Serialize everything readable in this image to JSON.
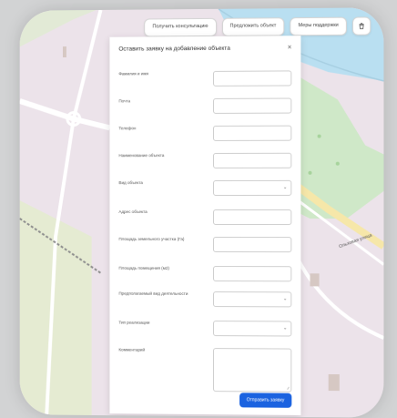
{
  "topbar": {
    "btn_consult": "Получить консультацию",
    "btn_offer": "Предложить объект",
    "btn_support": "Меры поддержки",
    "settings_icon": "settings-icon"
  },
  "modal": {
    "title": "Оставить заявку на добавление объекта",
    "close_icon": "×",
    "fields": [
      {
        "label": "Фамилия и имя",
        "type": "input",
        "value": "",
        "placeholder": ""
      },
      {
        "label": "Почта",
        "type": "input",
        "value": "",
        "placeholder": ""
      },
      {
        "label": "Телефон",
        "type": "input",
        "value": "",
        "placeholder": ""
      },
      {
        "label": "Наименование объекта",
        "type": "input",
        "value": "",
        "placeholder": ""
      },
      {
        "label": "Вид объекта",
        "type": "select",
        "value": "",
        "placeholder": ""
      },
      {
        "label": "Адрес объекта",
        "type": "input",
        "value": "",
        "placeholder": ""
      },
      {
        "label": "Площадь земельного участка (Га)",
        "type": "input",
        "value": "",
        "placeholder": ""
      },
      {
        "label": "Площадь помещения (м2)",
        "type": "input",
        "value": "",
        "placeholder": ""
      },
      {
        "label": "Предполагаемый вид деятельности",
        "type": "select",
        "value": "",
        "placeholder": ""
      },
      {
        "label": "Тип реализации",
        "type": "select",
        "value": "",
        "placeholder": ""
      },
      {
        "label": "Комментарий",
        "type": "textarea",
        "value": "",
        "placeholder": ""
      }
    ],
    "submit_label": "Отправить заявку"
  },
  "map": {
    "road_label": "Ольховая улица"
  },
  "colors": {
    "accent": "#1b63e0",
    "map_bg": "#ece3ea",
    "water": "#b9dff1",
    "park": "#cfe8c8",
    "page_bg": "#d2d3d4"
  }
}
